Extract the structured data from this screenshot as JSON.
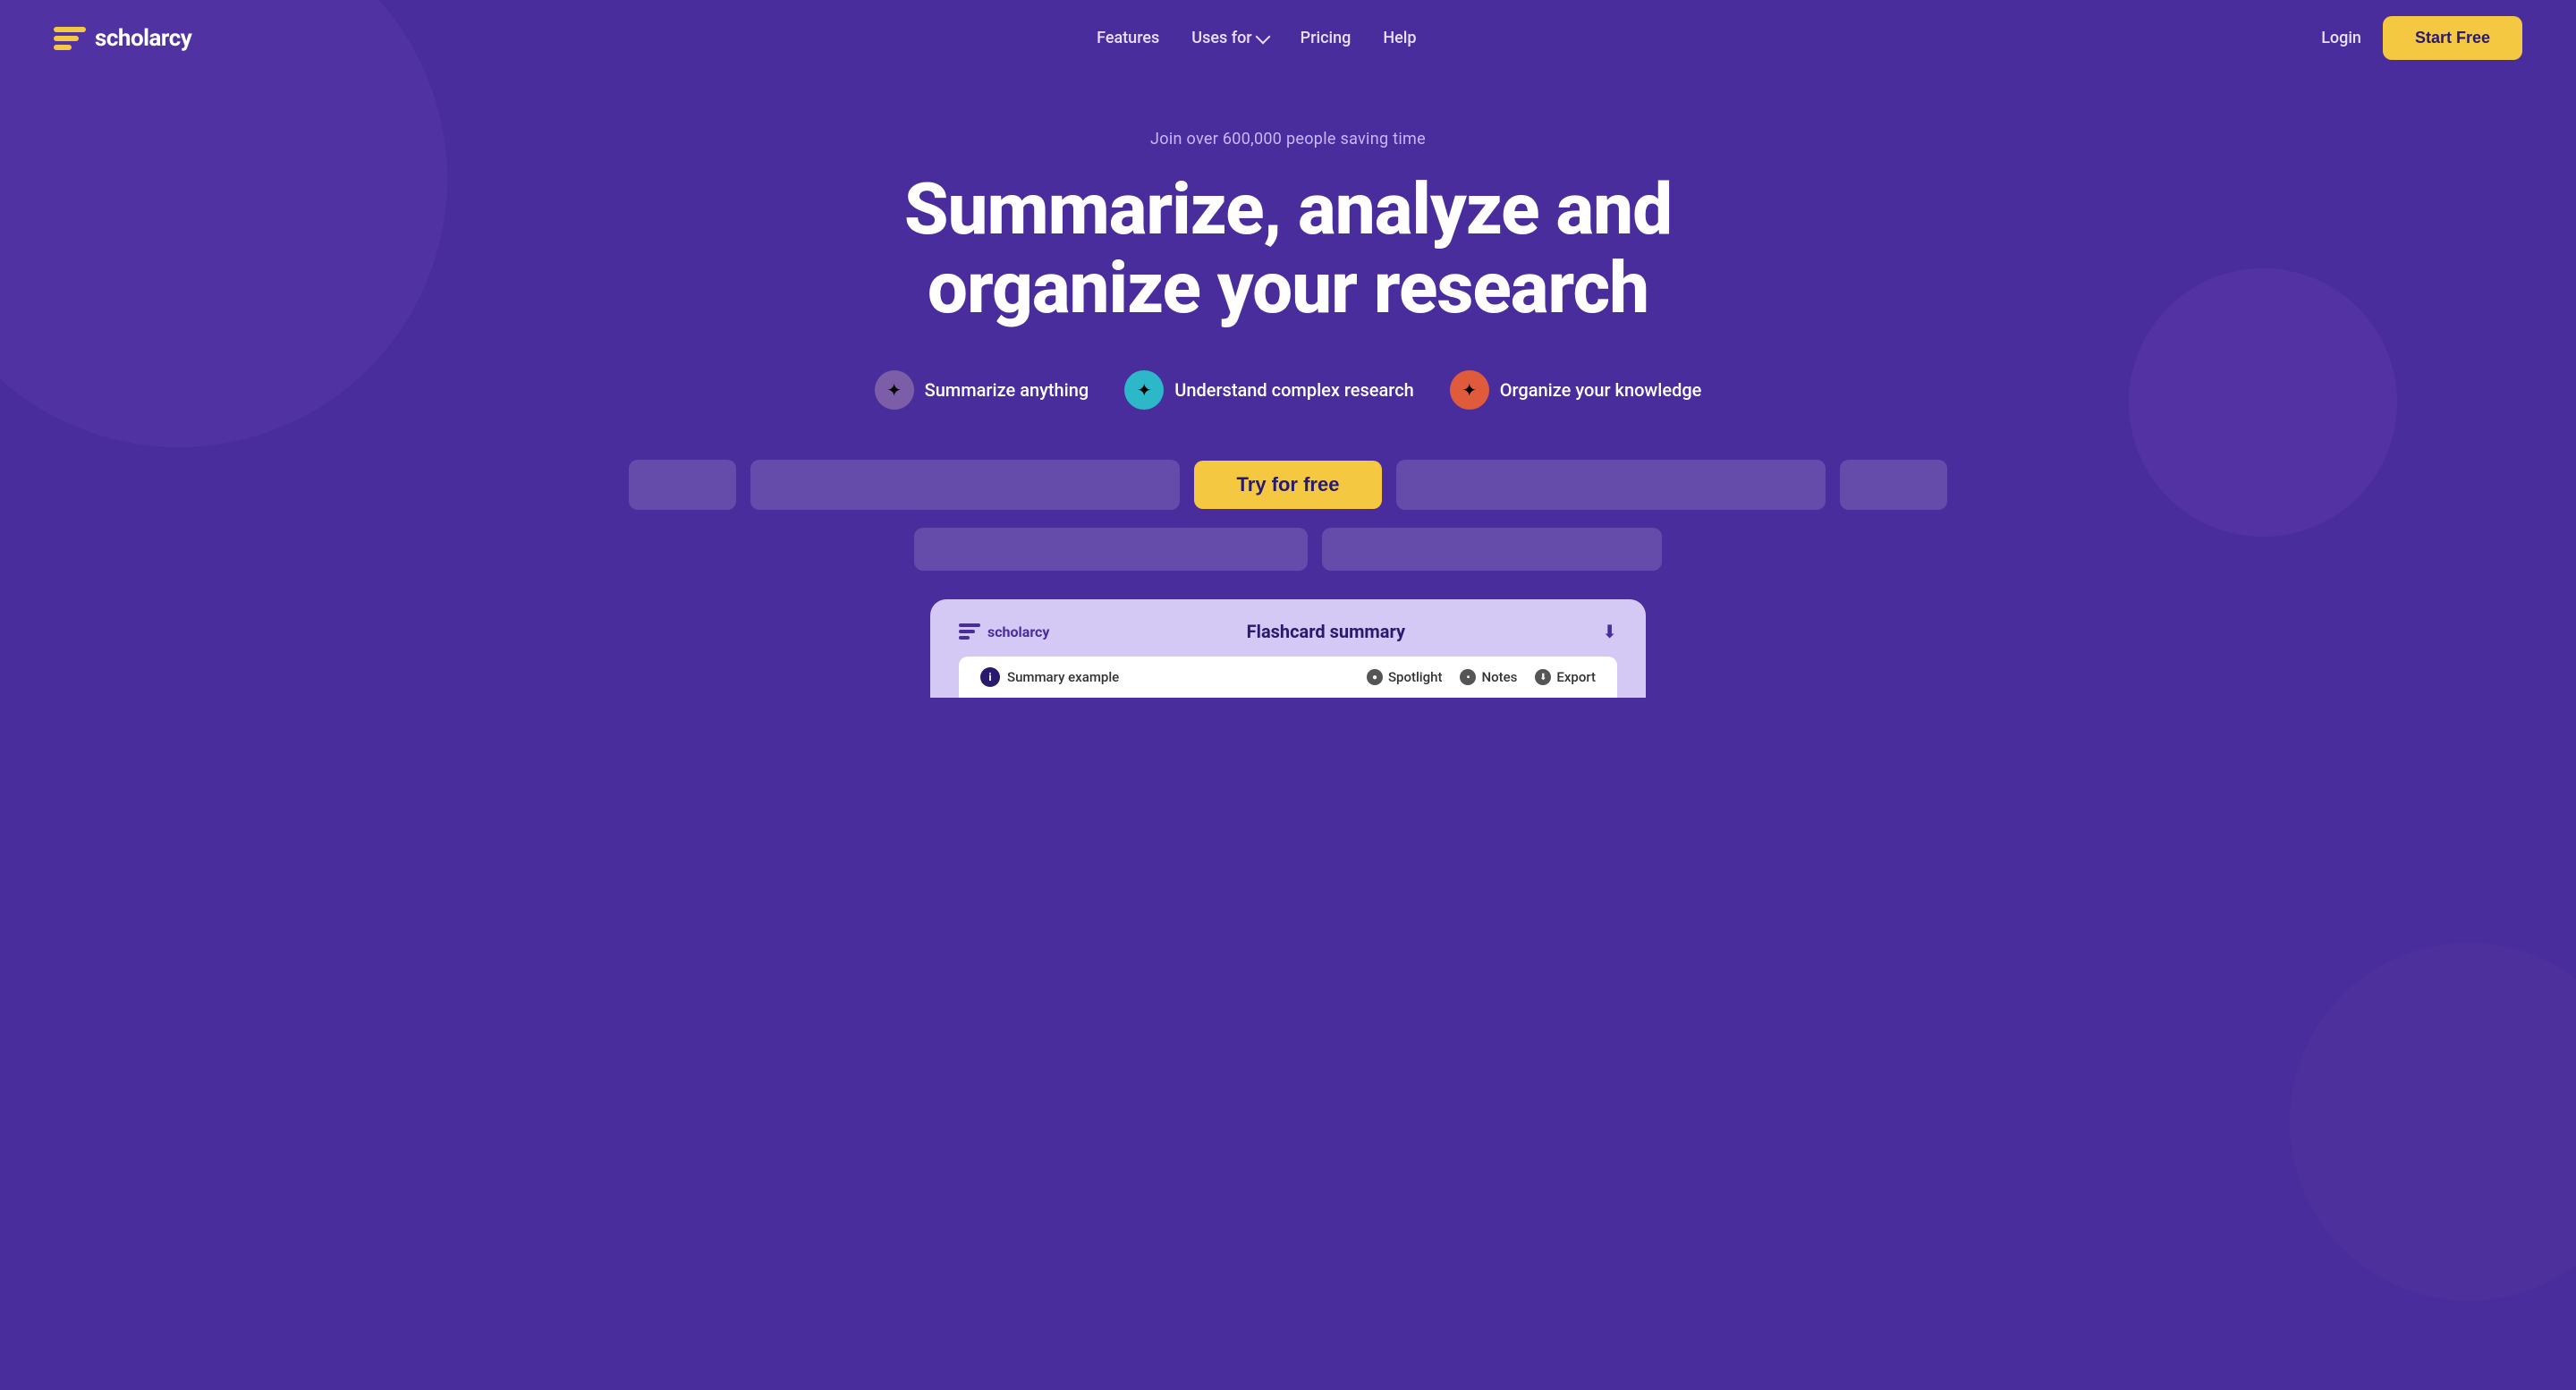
{
  "nav": {
    "logo_text": "scholarcy",
    "links": [
      {
        "id": "features",
        "label": "Features"
      },
      {
        "id": "uses-for",
        "label": "Uses for",
        "has_dropdown": true
      },
      {
        "id": "pricing",
        "label": "Pricing"
      },
      {
        "id": "help",
        "label": "Help"
      }
    ],
    "login_label": "Login",
    "start_free_label": "Start Free"
  },
  "hero": {
    "subtitle": "Join over 600,000 people saving time",
    "title_line1": "Summarize, analyze and",
    "title_line2": "organize your research"
  },
  "features": [
    {
      "id": "summarize",
      "icon": "✦",
      "icon_color": "purple",
      "label": "Summarize anything"
    },
    {
      "id": "understand",
      "icon": "✦",
      "icon_color": "cyan",
      "label": "Understand complex research"
    },
    {
      "id": "organize",
      "icon": "✦",
      "icon_color": "orange",
      "label": "Organize your knowledge"
    }
  ],
  "cta": {
    "try_free_label": "Try for free"
  },
  "card": {
    "logo_text": "scholarcy",
    "title": "Flashcard summary",
    "summary_label": "Summary example",
    "actions": [
      {
        "id": "spotlight",
        "label": "Spotlight"
      },
      {
        "id": "notes",
        "label": "Notes"
      },
      {
        "id": "export",
        "label": "Export"
      }
    ]
  },
  "colors": {
    "bg": "#4a2d9c",
    "nav_link": "#e8e0ff",
    "hero_title": "#ffffff",
    "cta_bg": "#f5c842",
    "cta_text": "#2a1a6e"
  }
}
